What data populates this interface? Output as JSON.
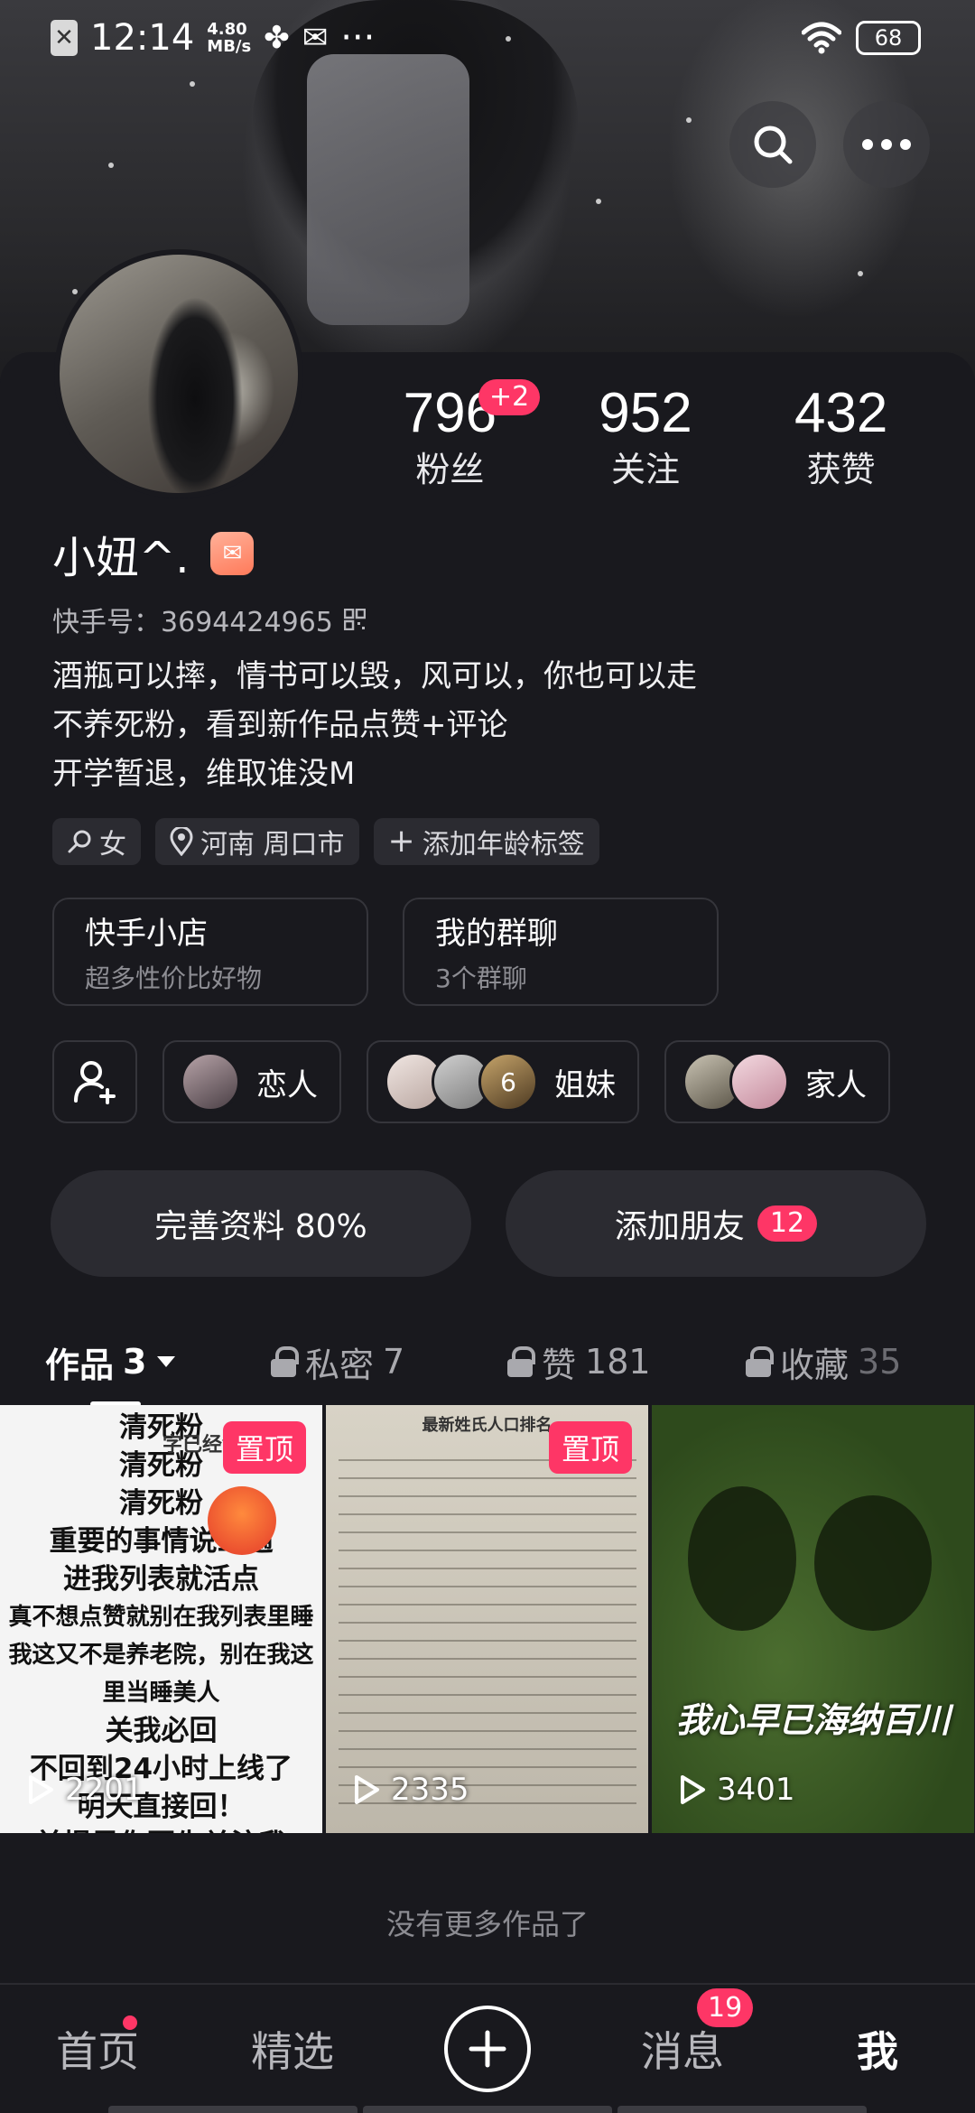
{
  "status_bar": {
    "time": "12:14",
    "net_speed": "4.80",
    "net_unit": "MB/s",
    "battery": "68",
    "more": "···"
  },
  "profile": {
    "name": "小妞^.",
    "kuaishou_id": "快手号：3694424965",
    "bio": [
      "酒瓶可以摔，情书可以毁，风可以，你也可以走",
      "不养死粉，看到新作品点赞+评论",
      "开学暂退，维取谁没M"
    ],
    "stats": [
      {
        "value": "796",
        "label": "粉丝",
        "badge": "+2"
      },
      {
        "value": "952",
        "label": "关注"
      },
      {
        "value": "432",
        "label": "获赞"
      }
    ],
    "tags": [
      {
        "icon": "gender-icon",
        "label": "女"
      },
      {
        "icon": "location-pin-icon",
        "label": "河南 周口市"
      },
      {
        "icon": "plus-icon",
        "label": "添加年龄标签"
      }
    ]
  },
  "cards": [
    {
      "title": "快手小店",
      "subtitle": "超多性价比好物"
    },
    {
      "title": "我的群聊",
      "subtitle": "3个群聊"
    }
  ],
  "groups": [
    {
      "label": "恋人"
    },
    {
      "label": "姐妹",
      "count": "6"
    },
    {
      "label": "家人"
    }
  ],
  "actions": {
    "complete_profile": "完善资料 80%",
    "add_friends": "添加朋友",
    "add_friends_badge": "12"
  },
  "tabs": [
    {
      "label": "作品",
      "count": "3"
    },
    {
      "label": "私密",
      "count": "7"
    },
    {
      "label": "赞",
      "count": "181"
    },
    {
      "label": "收藏",
      "count": "35"
    }
  ],
  "videos": [
    {
      "pinned": "置顶",
      "plays": "2201",
      "text": [
        "清死粉",
        "清死粉",
        "清死粉",
        "重要的事情说三遍",
        "进我列表就活点",
        "真不想点赞就别在我列表里睡",
        "我这又不是养老院，别在我这里当睡美人",
        "关我必回",
        "不回到24小时上线了",
        "明天直接回！",
        "前提是你要先关注我"
      ],
      "side_text": "字已经够"
    },
    {
      "pinned": "置顶",
      "plays": "2335",
      "text": "最新姓氏人口排名"
    },
    {
      "plays": "3401",
      "text": "我心早已海纳百川"
    }
  ],
  "footer_text": "没有更多作品了",
  "bottom_nav": {
    "home": "首页",
    "featured": "精选",
    "messages": "消息",
    "messages_badge": "19",
    "me": "我"
  },
  "colors": {
    "accent": "#fe3666",
    "background": "#19191e",
    "surface": "#2b2b31"
  }
}
